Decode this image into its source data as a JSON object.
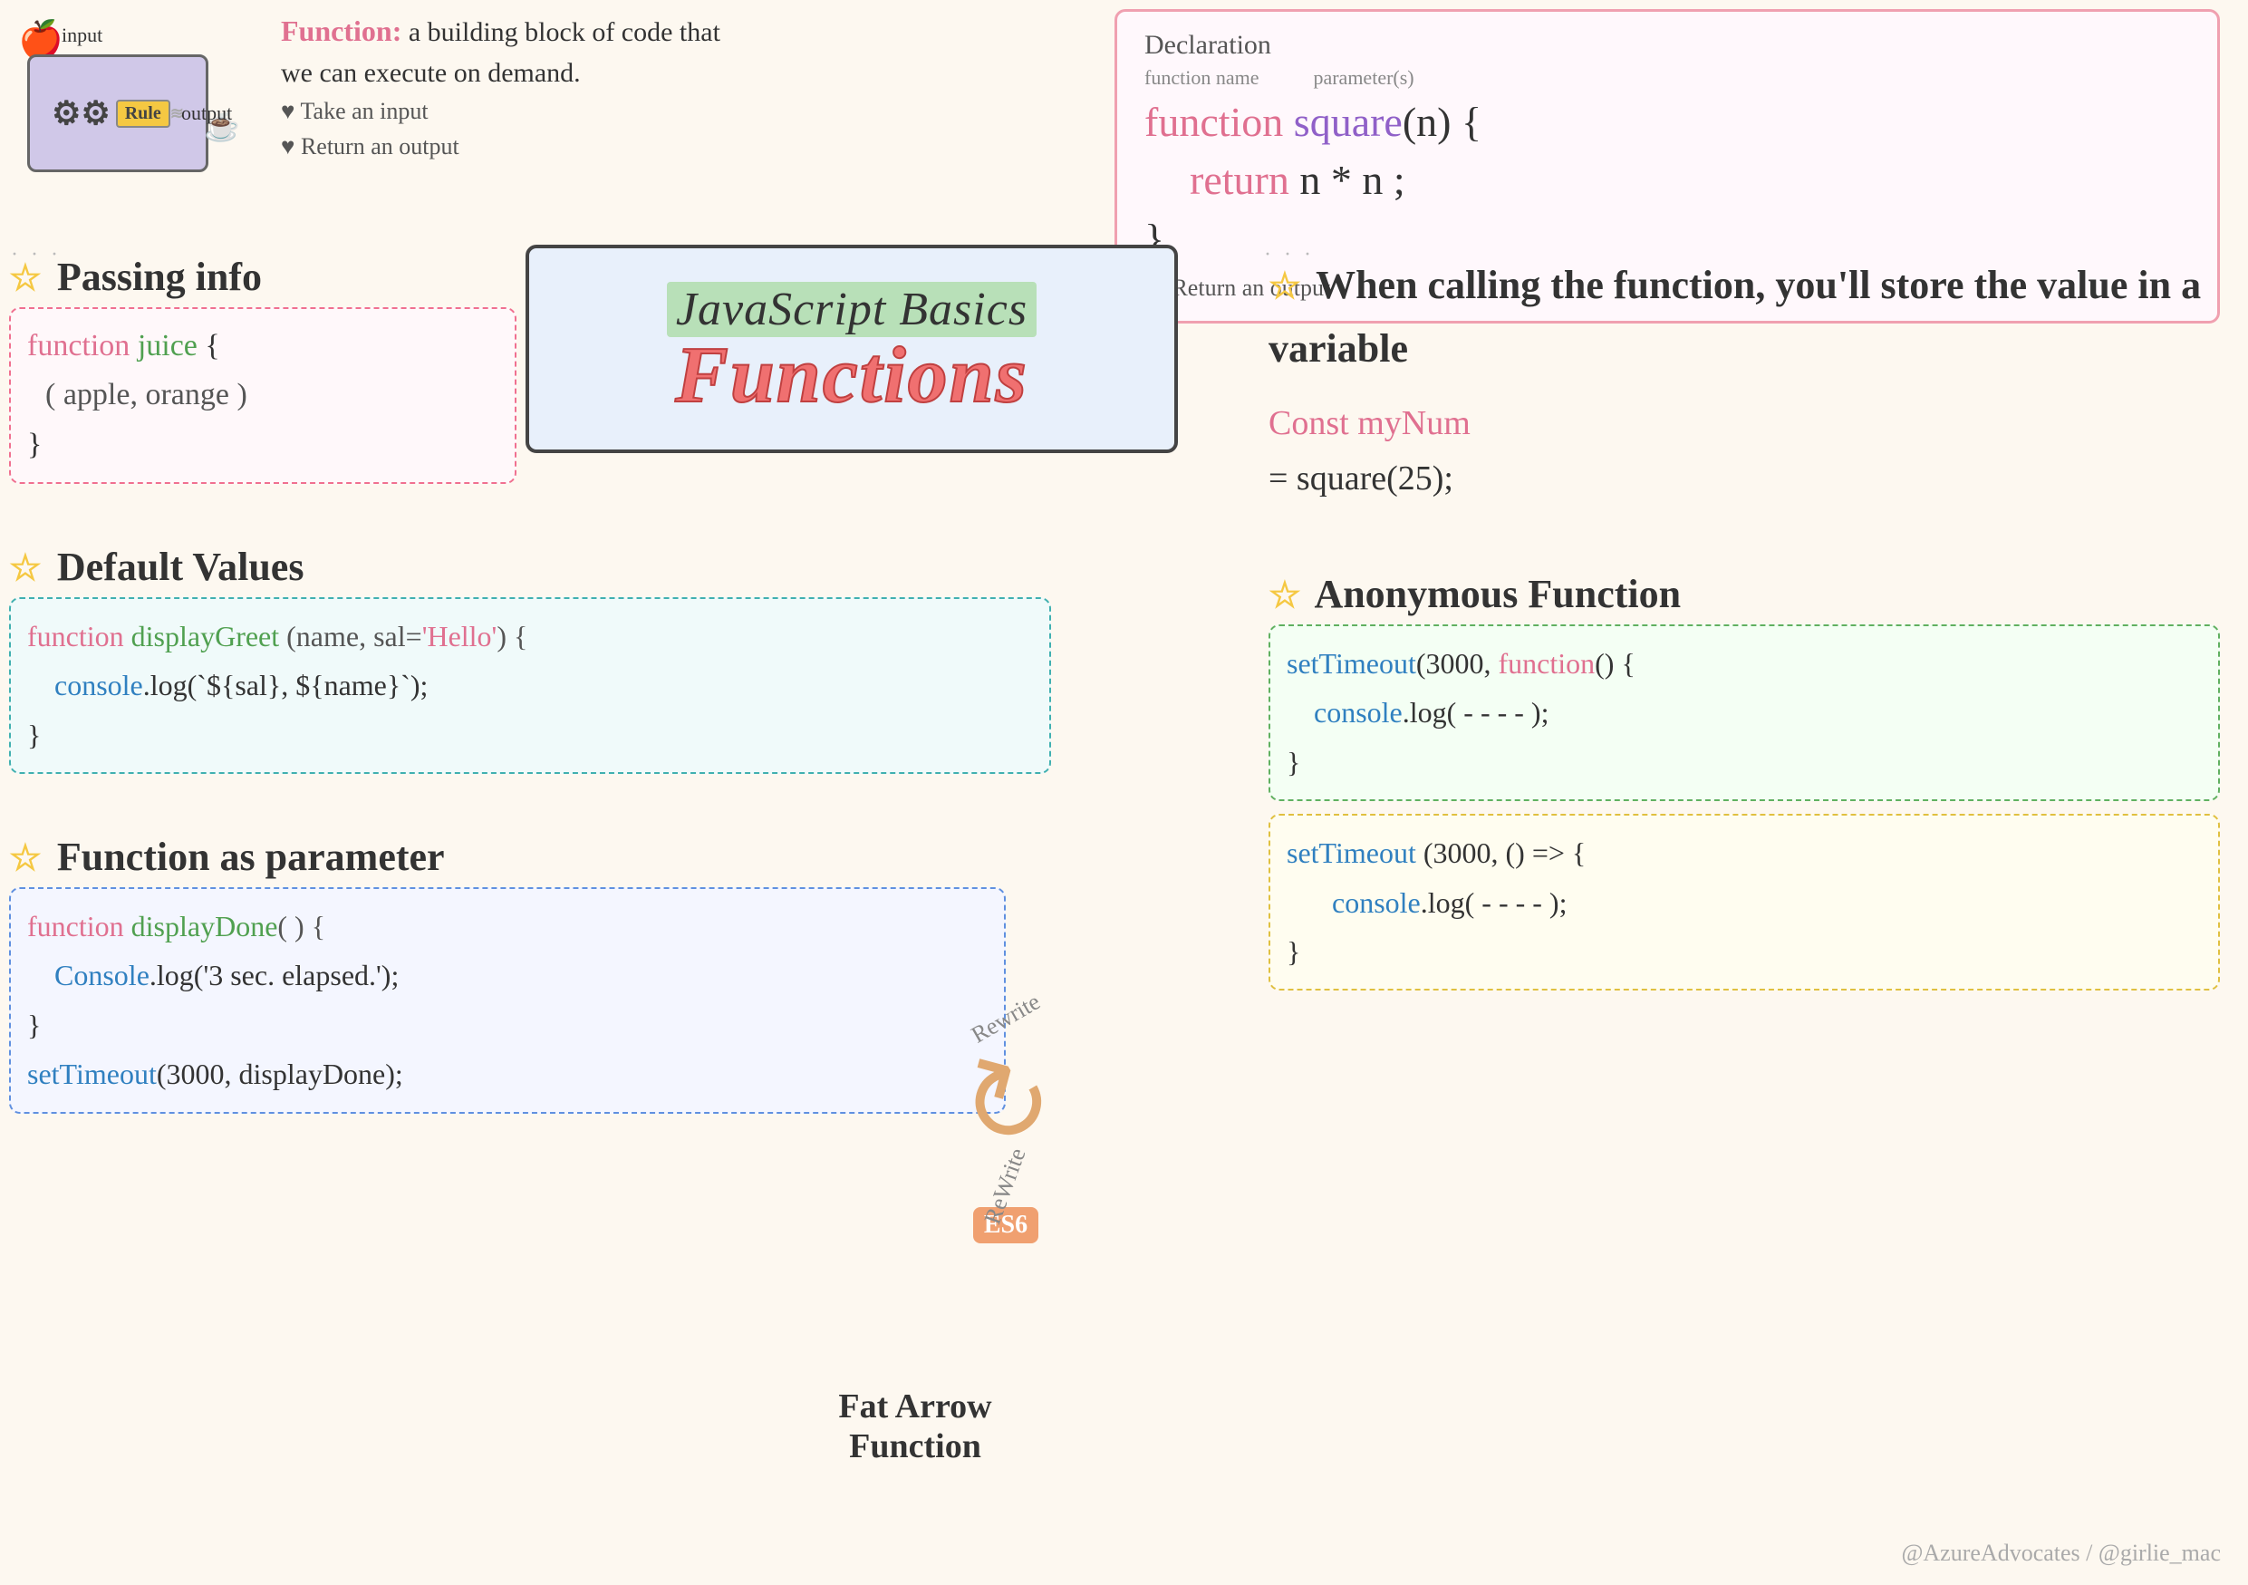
{
  "machine": {
    "apple": "🍎",
    "input_label": "input",
    "gears": "⚙",
    "rule_label": "Rule",
    "steam": "~~~",
    "output_label": "output",
    "cup": "☕"
  },
  "func_definition": {
    "title": "Function:",
    "description": "a building block of code that we can execute on demand.",
    "bullet1": "♥ Take an input",
    "bullet2": "♥ Return an output"
  },
  "declaration": {
    "title": "Declaration",
    "annotation1": "function name",
    "annotation2": "parameter(s)",
    "line1": "function square(n) {",
    "line2": "  return n * n ;",
    "line3": "}",
    "note": "Return an output"
  },
  "passing_info": {
    "star": "☆",
    "title": "Passing info",
    "code_line1": "function juice {",
    "code_line2": "( apple, orange )",
    "code_line3": "}"
  },
  "default_values": {
    "star": "☆",
    "title": "Default Values",
    "code_line1": "function displayGreet (name, sal='Hello') {",
    "code_line2": "  console.log(`${sal}, ${name}`);",
    "code_line3": "}"
  },
  "func_param": {
    "star": "☆",
    "title": "Function as parameter",
    "code_line1": "function displayDone( ) {",
    "code_line2": "  Console.log('3 sec. elapsed.');",
    "code_line3": "}",
    "code_line4": "setTimeout(3000, displayDone);"
  },
  "when_calling": {
    "star": "☆",
    "title": "When calling the function, you'll store the value in a variable",
    "code1": "Const myNum",
    "code2": "= square(25);"
  },
  "anon_func": {
    "star": "☆",
    "title": "Anonymous Function",
    "green_line1": "setTimeout(3000, function() {",
    "green_line2": "  console.log( ---- );",
    "green_line3": "}",
    "yellow_line1": "setTimeout (3000, () => {",
    "yellow_line2": "  console.log( ---- );",
    "yellow_line3": "}"
  },
  "rewrite": {
    "text1": "Rewrite",
    "text2": "ReWrite",
    "es6": "ES6",
    "arrow": "↩",
    "fat_arrow_title": "Fat Arrow Function"
  },
  "watermark": {
    "text": "@AzureAdvocates / @girlie_mac"
  },
  "title": {
    "script_text": "JavaScript Basics",
    "functions_text": "Functions"
  }
}
